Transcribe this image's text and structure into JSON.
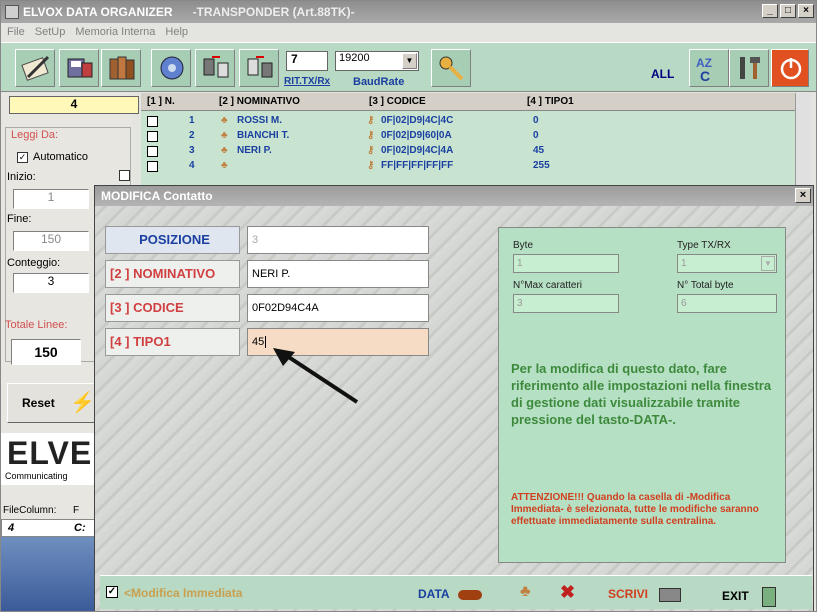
{
  "window": {
    "title": "ELVOX DATA ORGANIZER",
    "subtitle": "-TRANSPONDER (Art.88TK)-",
    "controls": [
      "_",
      "□",
      "×"
    ]
  },
  "menu": [
    "File",
    "SetUp",
    "Memoria Interna",
    "Help"
  ],
  "toolbar": {
    "rit_value": "7",
    "baud_value": "19200",
    "rit_label": "RIT.TX/Rx",
    "baud_label": "BaudRate",
    "all_label": "ALL",
    "colors": {
      "bg": "#b8d9c3",
      "accent": "#1a3fa0"
    }
  },
  "left_panel": {
    "counter": "4",
    "leggi_da": "Leggi Da:",
    "automatico": "Automatico",
    "inizio_label": "Inizio:",
    "inizio_value": "1",
    "fine_label": "Fine:",
    "fine_value": "150",
    "conteggio_label": "Conteggio:",
    "conteggio_value": "3",
    "totale_label": "Totale Linee:",
    "totale_value": "150",
    "reset_label": "Reset",
    "logo": "ELVE",
    "logo_sub": "Communicating",
    "filecolumn": "FileColumn:",
    "filecolumn_f": "F",
    "row4": "4",
    "row4b": "C:"
  },
  "grid": {
    "headers": [
      "[1 ] N.",
      "[2 ] NOMINATIVO",
      "[3 ] CODICE",
      "[4 ] TIPO1"
    ],
    "rows": [
      {
        "n": "1",
        "nome": "ROSSI M.",
        "codice": "0F|02|D9|4C|4C",
        "tipo": "0"
      },
      {
        "n": "2",
        "nome": "BIANCHI T.",
        "codice": "0F|02|D9|60|0A",
        "tipo": "0"
      },
      {
        "n": "3",
        "nome": "NERI P.",
        "codice": "0F|02|D9|4C|4A",
        "tipo": "45"
      },
      {
        "n": "4",
        "nome": "",
        "codice": "FF|FF|FF|FF|FF",
        "tipo": "255"
      }
    ]
  },
  "dialog": {
    "title": "MODIFICA Contatto",
    "close": "×",
    "fields": [
      {
        "label": "POSIZIONE",
        "value": "3"
      },
      {
        "label": "[2 ] NOMINATIVO",
        "value": "NERI P."
      },
      {
        "label": "[3 ] CODICE",
        "value": "0F02D94C4A"
      },
      {
        "label": "[4 ] TIPO1",
        "value": "45"
      }
    ],
    "right": {
      "byte_label": "Byte",
      "byte_value": "1",
      "type_label": "Type TX/RX",
      "type_value": "1",
      "nmax_label": "N°Max caratteri",
      "nmax_value": "3",
      "ntotal_label": "N° Total byte",
      "ntotal_value": "6",
      "info": "Per la modifica di questo dato,  fare riferimento alle impostazioni nella finestra di gestione dati visualizzabile tramite pressione del tasto-DATA-.",
      "warning": "ATTENZIONE!!! Quando la casella di -Modifica Immediata- è selezionata, tutte le modifiche saranno effettuate immediatamente sulla centralina."
    },
    "bottom": {
      "immediata": "<Modifica Immediata",
      "data": "DATA",
      "scrivi": "SCRIVI",
      "exit": "EXIT"
    }
  }
}
